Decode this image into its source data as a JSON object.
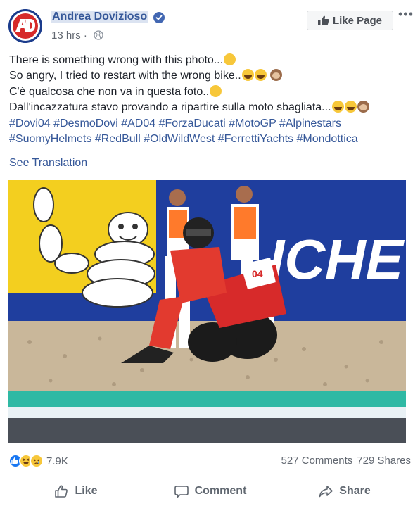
{
  "post": {
    "author": "Andrea Dovizioso",
    "time": "13 hrs",
    "meta_separator": " · ",
    "like_page_label": "Like Page",
    "more_label": "•••",
    "text_lines": {
      "l1": "There is something wrong with this photo...",
      "l2": "So angry, I tried to restart with the wrong bike..",
      "l3": "C'è qualcosa che non va in questa foto..",
      "l4": "Dall'incazzatura stavo provando a ripartire sulla moto sbagliata..."
    },
    "hashtags": {
      "h1": "#Dovi04",
      "h2": "#DesmoDovi",
      "h3": "#AD04",
      "h4": "#ForzaDucati",
      "h5": "#MotoGP",
      "h6": "#Alpinestars",
      "h7": "#SuomyHelmets",
      "h8": "#RedBull",
      "h9": "#OldWildWest",
      "h10": "#FerrettiYachts",
      "h11": "#Mondottica"
    },
    "see_translation": "See Translation",
    "photo": {
      "banner_text": "ICHE",
      "rider_number": "04"
    },
    "reactions_count": "7.9K",
    "comments": "527 Comments",
    "shares": "729 Shares",
    "actions": {
      "like": "Like",
      "comment": "Comment",
      "share": "Share"
    }
  },
  "colors": {
    "link": "#365899",
    "text": "#1d2129",
    "muted": "#616770",
    "fb_blue": "#1877f2"
  }
}
